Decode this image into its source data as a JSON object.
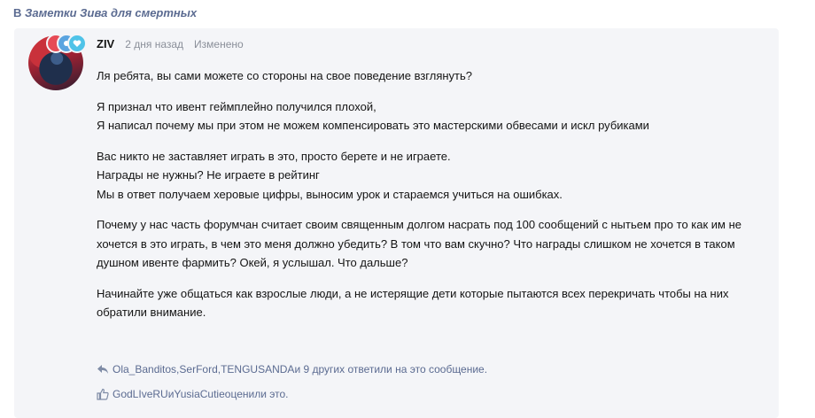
{
  "breadcrumb": {
    "prefix": "В",
    "link": "Заметки Зива для смертных"
  },
  "post": {
    "author": "ZIV",
    "date": "2 дня назад",
    "edited": "Изменено",
    "paragraphs": [
      [
        "Ля ребята, вы сами можете со стороны на свое поведение взглянуть?"
      ],
      [
        "Я признал что ивент геймплейно получился плохой,",
        "Я написал почему мы при этом не можем компенсировать это мастерскими обвесами и искл рубиками"
      ],
      [
        "Вас никто не заставляет играть в это, просто берете и не играете.",
        "Награды не нужны? Не играете в рейтинг",
        "Мы в ответ получаем херовые цифры, выносим урок и стараемся учиться на ошибках."
      ],
      [
        "Почему у нас часть форумчан считает своим священным долгом насрать под 100 сообщений с нытьем про то как им не хочется в это играть, в чем это меня должно убедить? В том что вам скучно? Что награды слишком не хочется в таком душном ивенте фармить? Окей, я услышал. Что дальше?"
      ],
      [
        "Начинайте уже общаться как взрослые люди, а не истерящие дети которые пытаются всех перекричать чтобы на них обратили внимание."
      ]
    ]
  },
  "replies": {
    "user1": "Ola_Banditos",
    "sep1": ", ",
    "user2": "SerFord",
    "sep2": ", ",
    "user3": "TENGUSANDA",
    "tail": " и 9 других ответили на это сообщение."
  },
  "likes": {
    "user1": "GodLIveRU",
    "sep": " и ",
    "user2": "YusiaCutie",
    "tail": " оценили это."
  },
  "icons": {
    "reply": "reply-arrow-icon",
    "like": "thumbs-up-icon"
  },
  "colors": {
    "accent": "#5b6b91",
    "card": "#f4f5f8"
  }
}
